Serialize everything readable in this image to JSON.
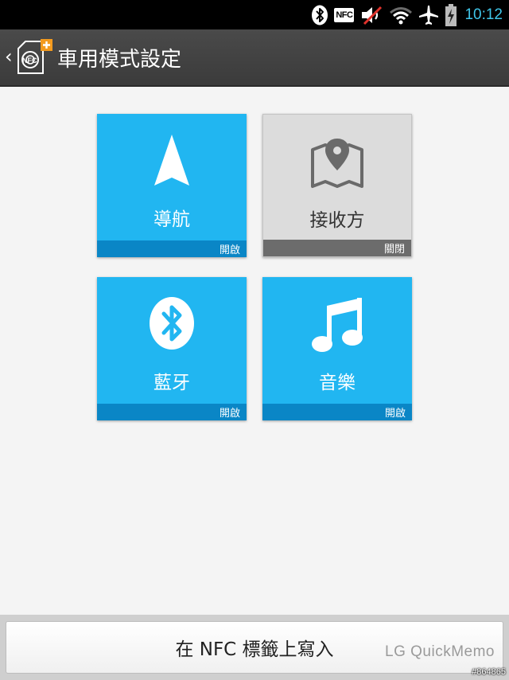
{
  "status_bar": {
    "icons": [
      "bluetooth-icon",
      "nfc-icon",
      "volume-muted-icon",
      "wifi-icon",
      "airplane-icon",
      "battery-charging-icon"
    ],
    "nfc_label": "NFC",
    "time": "10:12",
    "accent_color": "#3fc6ea"
  },
  "title_bar": {
    "icon_text": "NFC",
    "title": "車用模式設定"
  },
  "tiles": [
    {
      "label": "導航",
      "status": "開啟",
      "state": "on",
      "icon": "navigation-arrow-icon"
    },
    {
      "label": "接收方",
      "status": "關閉",
      "state": "off",
      "icon": "map-pin-icon"
    },
    {
      "label": "藍牙",
      "status": "開啟",
      "state": "on",
      "icon": "bluetooth-icon"
    },
    {
      "label": "音樂",
      "status": "開啟",
      "state": "on",
      "icon": "music-note-icon"
    }
  ],
  "bottom_button": {
    "label": "在 NFC 標籤上寫入"
  },
  "watermark": {
    "text": "LG QuickMemo",
    "id": "#864865"
  },
  "colors": {
    "tile_on": "#21b6f1",
    "tile_on_strip": "#0a86c6",
    "tile_off": "#dcdcdc",
    "tile_off_strip": "#6c6c6c"
  }
}
